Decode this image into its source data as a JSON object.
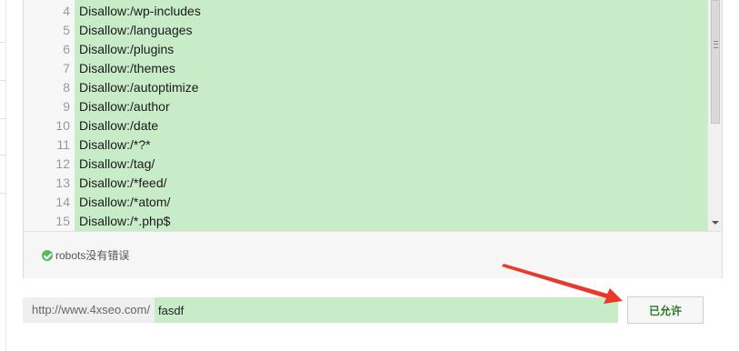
{
  "editor": {
    "lines": [
      {
        "num": "4",
        "text": "Disallow:/wp-includes"
      },
      {
        "num": "5",
        "text": "Disallow:/languages"
      },
      {
        "num": "6",
        "text": "Disallow:/plugins"
      },
      {
        "num": "7",
        "text": "Disallow:/themes"
      },
      {
        "num": "8",
        "text": "Disallow:/autoptimize"
      },
      {
        "num": "9",
        "text": "Disallow:/author"
      },
      {
        "num": "10",
        "text": "Disallow:/date"
      },
      {
        "num": "11",
        "text": "Disallow:/*?*"
      },
      {
        "num": "12",
        "text": "Disallow:/tag/"
      },
      {
        "num": "13",
        "text": "Disallow:/*feed/"
      },
      {
        "num": "14",
        "text": "Disallow:/*atom/"
      },
      {
        "num": "15",
        "text": "Disallow:/*.php$"
      }
    ]
  },
  "status": {
    "icon": "check-circle-icon",
    "text": "robots没有错误"
  },
  "url_check": {
    "prefix": "http://www.4xseo.com/",
    "value": "fasdf",
    "button_label": "已允许"
  },
  "colors": {
    "highlight": "#c8ecc8",
    "ok_green": "#5cb85c",
    "arrow_red": "#e8392c"
  }
}
